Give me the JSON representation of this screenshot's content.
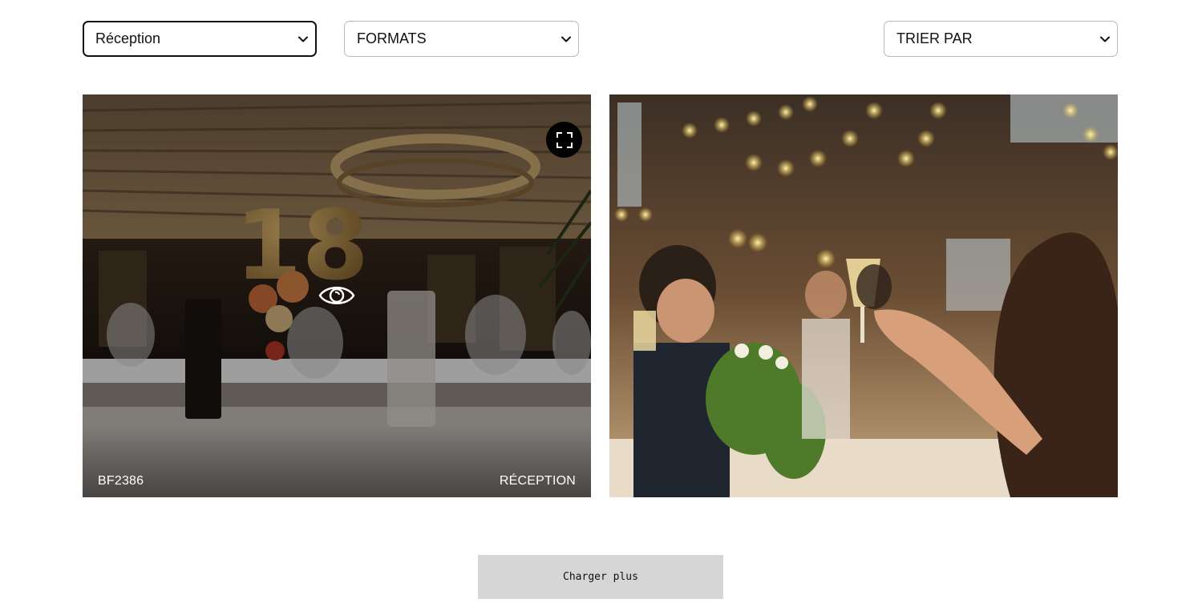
{
  "filters": {
    "category": {
      "selected": "Réception",
      "icon": "chevron-down-icon"
    },
    "formats": {
      "selected": "FORMATS",
      "icon": "chevron-down-icon"
    },
    "sort": {
      "selected": "TRIER PAR",
      "icon": "chevron-down-icon"
    }
  },
  "gallery": {
    "items": [
      {
        "reference": "BF2386",
        "category": "RÉCEPTION",
        "image": "decorated-banquet-hall-with-18-balloons",
        "hovered": true,
        "icons": [
          "expand-icon",
          "eye-icon"
        ]
      },
      {
        "image": "guests-toasting-champagne-at-long-table"
      }
    ]
  },
  "load_more": {
    "label": "Charger plus"
  },
  "colors": {
    "overlay": "#000000",
    "button_bg": "#d6d6d6",
    "border": "#b9b9b9",
    "focus_border": "#111111"
  }
}
